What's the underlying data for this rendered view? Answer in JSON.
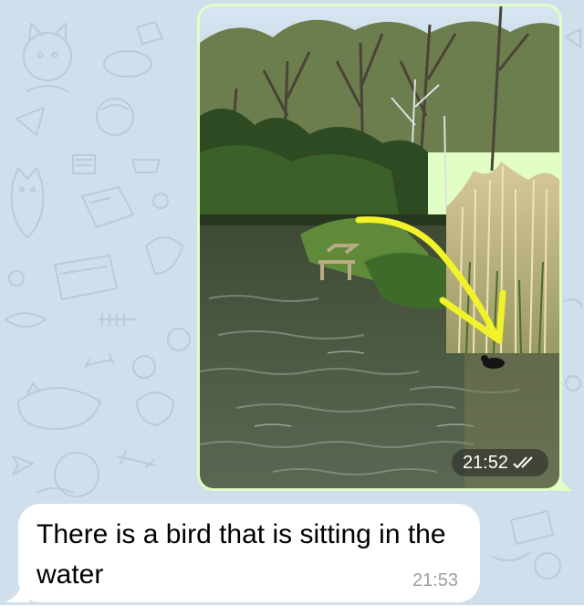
{
  "chat": {
    "background_color": "#cfdfeb",
    "outgoing_bubble_color": "#e1fec6",
    "incoming_bubble_color": "#ffffff"
  },
  "messages": [
    {
      "direction": "outgoing",
      "type": "photo",
      "time": "21:52",
      "status_icon": "double-check-icon",
      "annotation": "yellow-arrow-drawing"
    },
    {
      "direction": "incoming",
      "type": "text",
      "text": "There is a bird that is sitting in the water",
      "time": "21:53"
    }
  ]
}
